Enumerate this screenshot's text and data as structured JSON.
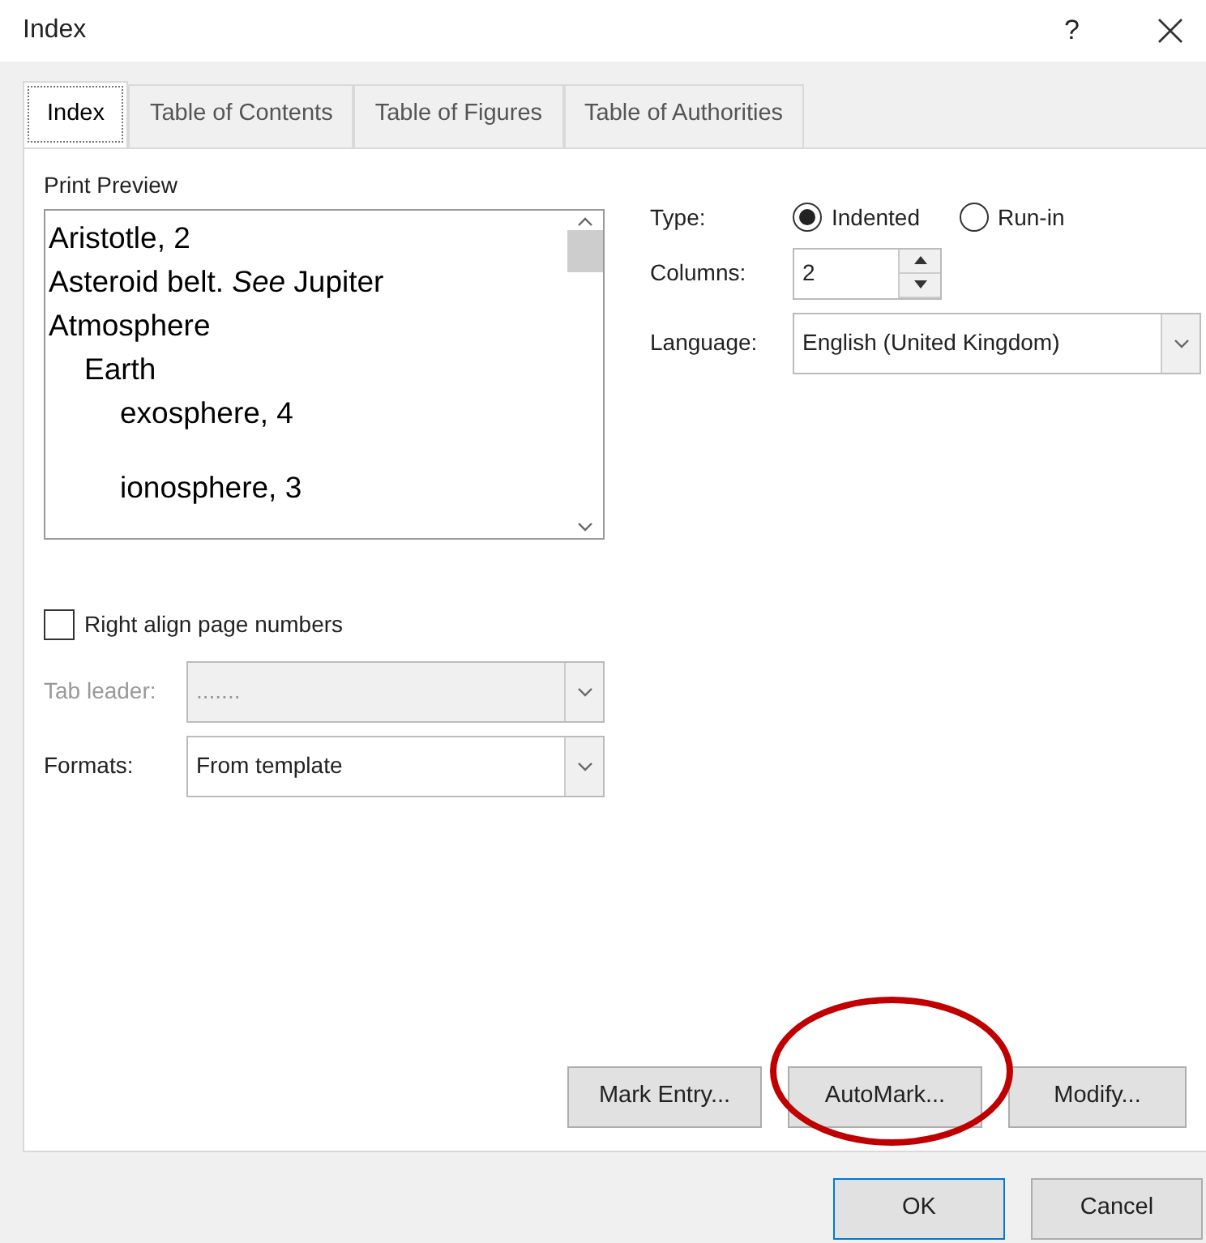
{
  "window": {
    "title": "Index",
    "help": "?"
  },
  "tabs": [
    {
      "label": "Index",
      "selected": true
    },
    {
      "label": "Table of Contents",
      "selected": false
    },
    {
      "label": "Table of Figures",
      "selected": false
    },
    {
      "label": "Table of Authorities",
      "selected": false
    }
  ],
  "preview": {
    "label": "Print Preview",
    "entries": [
      {
        "text": "Aristotle, 2"
      },
      {
        "text": "Asteroid belt. *See* Jupiter"
      },
      {
        "text": "Atmosphere",
        "children": [
          {
            "text": "Earth",
            "children": [
              {
                "text": "exosphere, 4"
              },
              {
                "text": "ionosphere, 3"
              }
            ]
          }
        ]
      }
    ]
  },
  "type": {
    "label": "Type:",
    "options": [
      {
        "label": "Indented",
        "selected": true
      },
      {
        "label": "Run-in",
        "selected": false
      }
    ]
  },
  "columns": {
    "label": "Columns:",
    "value": "2"
  },
  "language": {
    "label": "Language:",
    "value": "English (United Kingdom)"
  },
  "right_align": {
    "label": "Right align page numbers",
    "checked": false
  },
  "tab_leader": {
    "label": "Tab leader:",
    "value": ".......",
    "disabled": true
  },
  "formats": {
    "label": "Formats:",
    "value": "From template",
    "disabled": false
  },
  "action_buttons": [
    {
      "label": "Mark Entry...",
      "circled": false
    },
    {
      "label": "AutoMark...",
      "circled": true
    },
    {
      "label": "Modify...",
      "circled": false
    }
  ],
  "dialog_buttons": [
    {
      "label": "OK",
      "default": true
    },
    {
      "label": "Cancel",
      "default": false
    }
  ]
}
